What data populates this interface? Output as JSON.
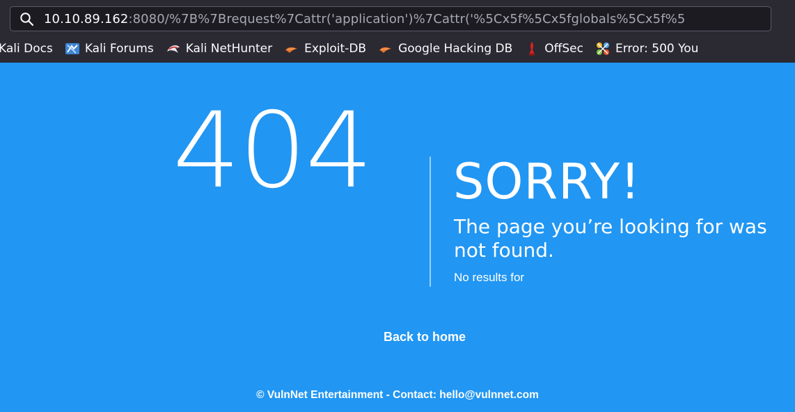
{
  "browser": {
    "url_host": "10.10.89.162",
    "url_rest": ":8080/%7B%7Brequest%7Cattr('application')%7Cattr('%5Cx5f%5Cx5fglobals%5Cx5f%5",
    "search_icon": "search-icon",
    "bookmarks": [
      {
        "label": "Kali Docs",
        "icon": "kali-docs-icon"
      },
      {
        "label": "Kali Forums",
        "icon": "kali-forums-icon"
      },
      {
        "label": "Kali NetHunter",
        "icon": "kali-nethunter-icon"
      },
      {
        "label": "Exploit-DB",
        "icon": "exploit-db-icon"
      },
      {
        "label": "Google Hacking DB",
        "icon": "google-hacking-db-icon"
      },
      {
        "label": "OffSec",
        "icon": "offsec-icon"
      },
      {
        "label": "Error: 500 You",
        "icon": "error-500-icon"
      }
    ]
  },
  "page": {
    "code": "404",
    "heading": "SORRY!",
    "message": "The page you’re looking for was not found.",
    "no_results": "No results for",
    "back_link": "Back to home",
    "footer": "© VulnNet Entertainment - Contact: hello@vulnnet.com"
  },
  "colors": {
    "page_background": "#2196f3",
    "chrome_background": "#2b2a33",
    "text": "#ffffff"
  }
}
